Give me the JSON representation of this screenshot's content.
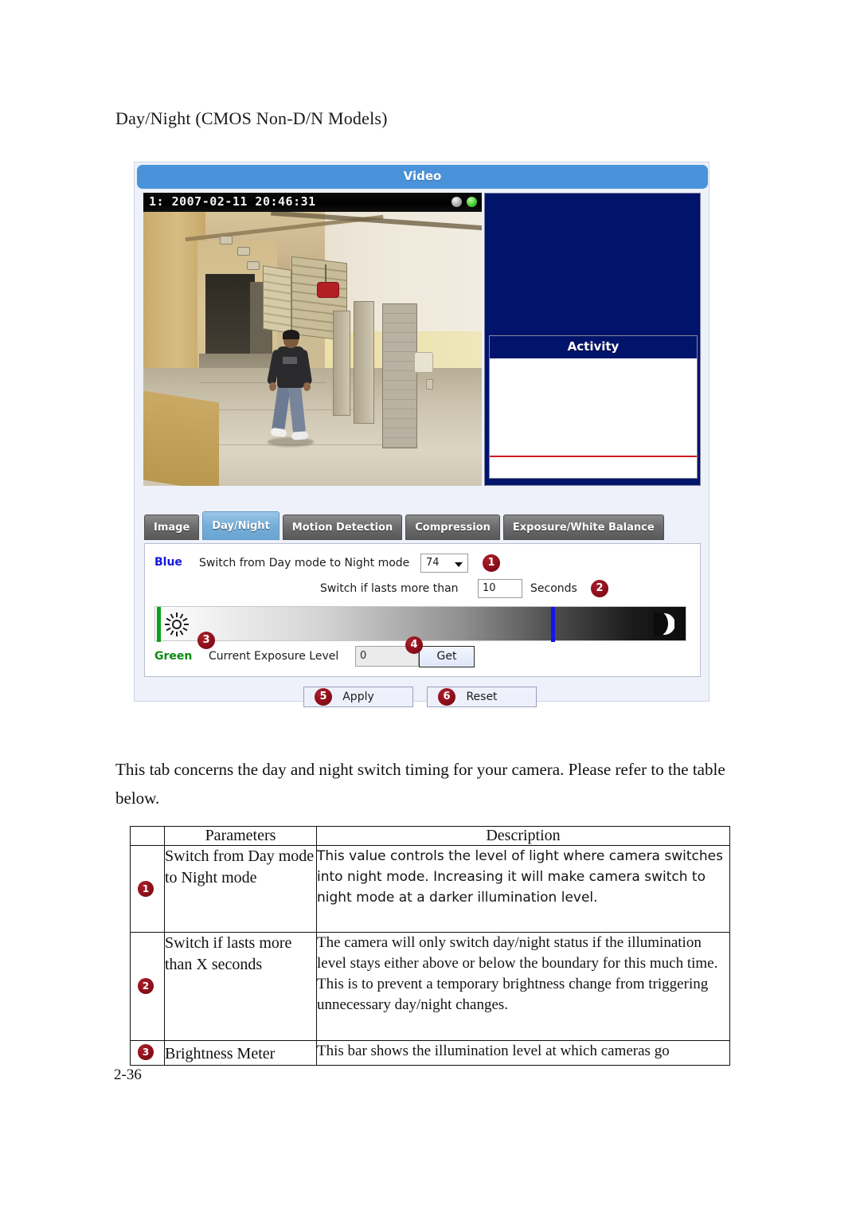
{
  "document": {
    "heading": "Day/Night (CMOS Non-D/N Models)",
    "paragraph": "This tab concerns the day and night switch timing for your camera. Please refer to the table below.",
    "page_number": "2-36"
  },
  "screenshot": {
    "window_title": "Video",
    "video": {
      "osd_text": "1:  2007-02-11 20:46:31",
      "led_gray": "status-led-gray",
      "led_green": "status-led-green"
    },
    "activity": {
      "title": "Activity"
    },
    "tabs": [
      {
        "label": "Image",
        "active": false
      },
      {
        "label": "Day/Night",
        "active": true
      },
      {
        "label": "Motion Detection",
        "active": false
      },
      {
        "label": "Compression",
        "active": false
      },
      {
        "label": "Exposure/White Balance",
        "active": false
      }
    ],
    "settings": {
      "blue_label": "Blue",
      "green_label": "Green",
      "switch_day_to_night_label": "Switch from Day mode to Night mode",
      "switch_day_to_night_value": "74",
      "switch_lasts_label": "Switch if lasts more than",
      "switch_lasts_value": "10",
      "seconds_label": "Seconds",
      "current_exposure_label": "Current Exposure Level",
      "current_exposure_value": "0",
      "get_button": "Get",
      "meter": {
        "sun_icon": "sun-icon",
        "moon_icon": "moon-icon",
        "green_marker_color": "#0AA21A",
        "blue_marker_color": "#1414F0"
      }
    },
    "actions": {
      "apply": "Apply",
      "reset": "Reset"
    },
    "callouts": {
      "one": "1",
      "two": "2",
      "three": "3",
      "four": "4",
      "five": "5",
      "six": "6"
    },
    "colors": {
      "titlebar_blue": "#4A93DB",
      "active_tab_blue": "#75AED8",
      "activity_navy": "#00146B",
      "callout_red": "#8E0F1A",
      "blue_label": "#1616DD",
      "green_label": "#0A8A10"
    }
  },
  "table": {
    "headers": [
      "",
      "Parameters",
      "Description"
    ],
    "rows": [
      {
        "num": "1",
        "parameter": "Switch from Day mode to Night mode",
        "description": "This value controls the level of light where camera switches into night mode. Increasing it will make camera switch to night mode at a darker illumination level.",
        "desc_font": "sans"
      },
      {
        "num": "2",
        "parameter": "Switch if lasts more than X seconds",
        "description": "The camera will only switch day/night status if the illumination level stays either above or below the boundary for this much time. This is to prevent a temporary brightness change from triggering unnecessary day/night changes.",
        "desc_font": "serif"
      },
      {
        "num": "3",
        "parameter": "Brightness Meter",
        "description": "This bar shows the illumination level at which cameras go",
        "desc_font": "serif"
      }
    ]
  }
}
